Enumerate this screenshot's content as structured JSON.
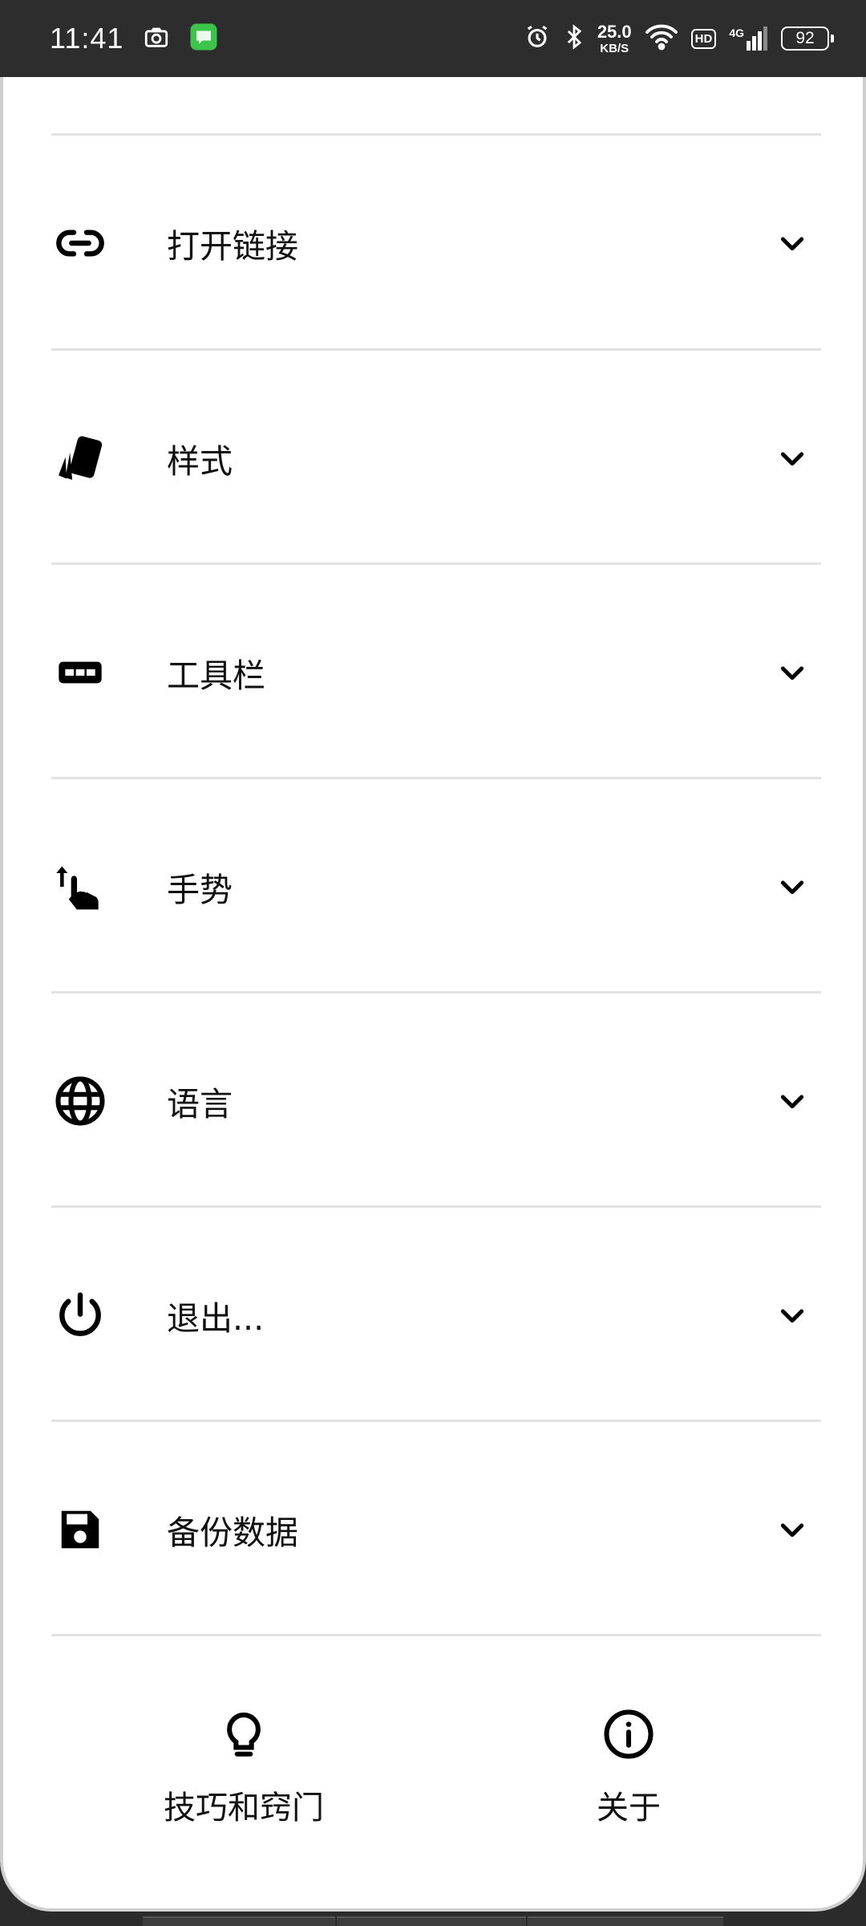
{
  "status_bar": {
    "time": "11:41",
    "speed_value": "25.0",
    "speed_unit": "KB/S",
    "hd": "HD",
    "network": "4G",
    "battery": "92"
  },
  "menu": {
    "items": [
      {
        "label": "打开链接",
        "icon": "link-icon"
      },
      {
        "label": "样式",
        "icon": "style-cards-icon"
      },
      {
        "label": "工具栏",
        "icon": "toolbar-icon"
      },
      {
        "label": "手势",
        "icon": "swipe-up-gesture-icon"
      },
      {
        "label": "语言",
        "icon": "globe-icon"
      },
      {
        "label": "退出...",
        "icon": "power-icon"
      },
      {
        "label": "备份数据",
        "icon": "save-icon"
      }
    ]
  },
  "bottom": {
    "tips_label": "技巧和窍门",
    "about_label": "关于"
  }
}
